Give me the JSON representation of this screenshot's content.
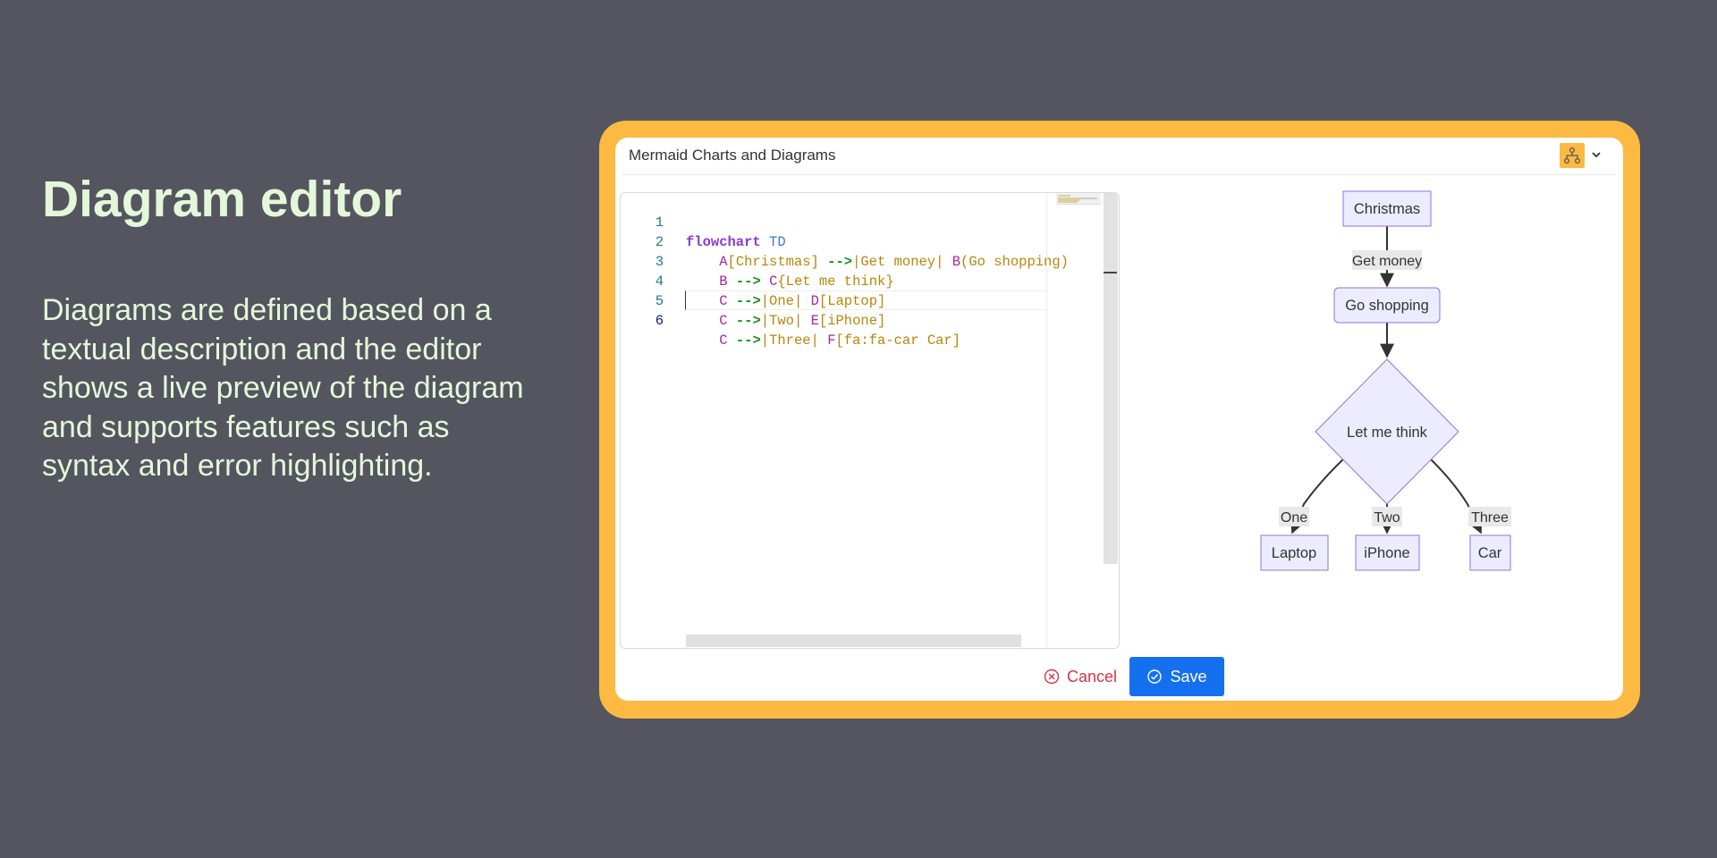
{
  "slide": {
    "headline": "Diagram editor",
    "description": "Diagrams are defined based on a textual description and the editor shows a live preview of the diagram and supports features such as syntax and error highlighting."
  },
  "dialog": {
    "title": "Mermaid Charts and Diagrams",
    "type_icon": "diagram-nodes-icon",
    "cancel_label": "Cancel",
    "save_label": "Save",
    "accent_color": "#fcba42",
    "save_color": "#1570ef",
    "cancel_color": "#d9334a"
  },
  "editor": {
    "line_numbers": [
      "1",
      "2",
      "3",
      "4",
      "5",
      "6"
    ],
    "active_line": "6",
    "lines": [
      "flowchart TD",
      "    A[Christmas] -->|Get money| B(Go shopping)",
      "    B --> C{Let me think}",
      "    C -->|One| D[Laptop]",
      "    C -->|Two| E[iPhone]",
      "    C -->|Three| F[fa:fa-car Car]"
    ]
  },
  "preview": {
    "nodes": {
      "christmas": "Christmas",
      "go_shopping": "Go shopping",
      "let_me_think": "Let me think",
      "laptop": "Laptop",
      "iphone": "iPhone",
      "car": "Car"
    },
    "edge_labels": {
      "get_money": "Get money",
      "one": "One",
      "two": "Two",
      "three": "Three"
    },
    "node_fill": "#ececff",
    "node_stroke": "#9370db"
  }
}
